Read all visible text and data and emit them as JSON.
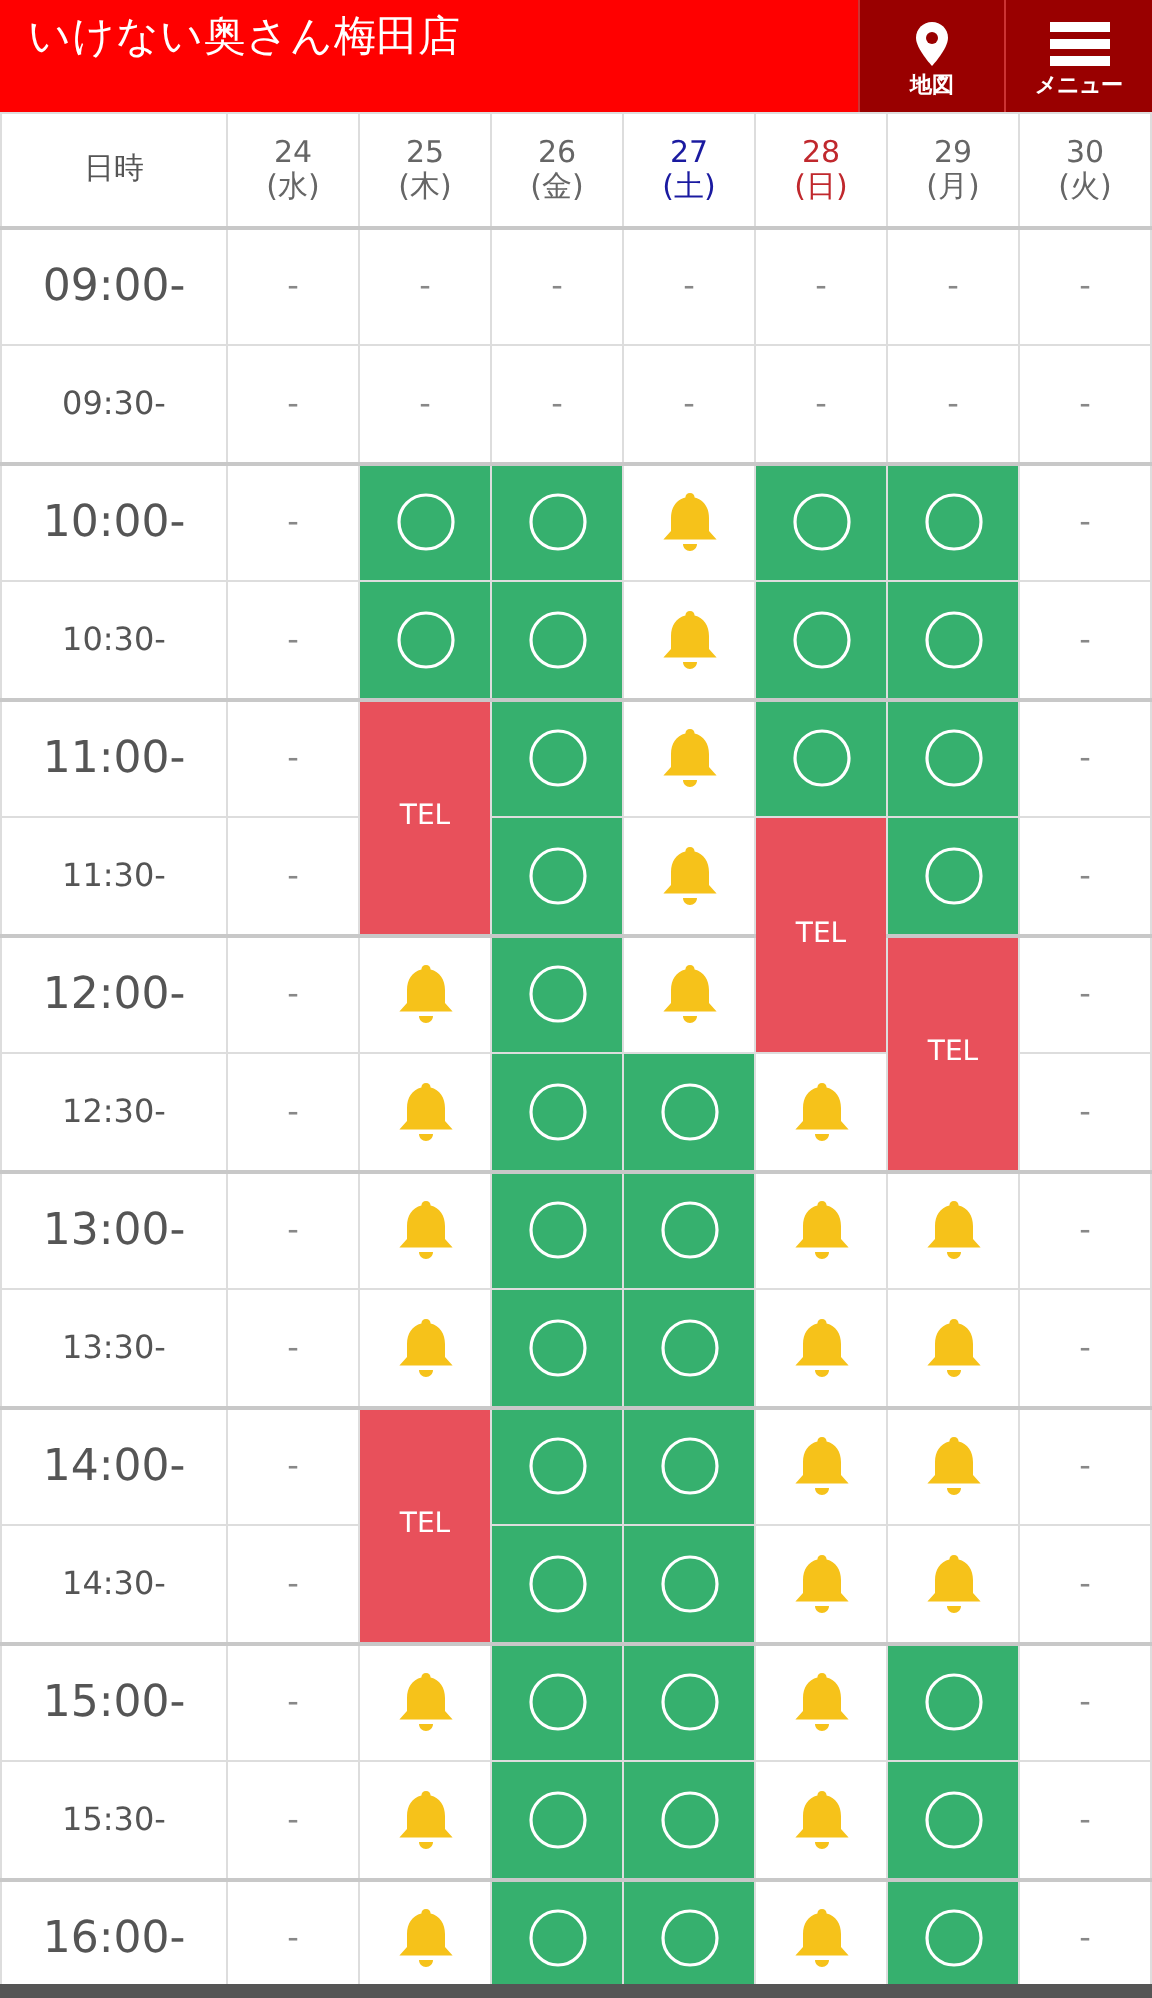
{
  "header": {
    "title": "いけない奥さん梅田店",
    "buttons": [
      {
        "kind": "map",
        "label": "地図"
      },
      {
        "kind": "menu",
        "label": "メニュー"
      }
    ]
  },
  "table": {
    "corner": "日時",
    "days": [
      {
        "date": "24",
        "weekday": "(水)",
        "color": "#666666"
      },
      {
        "date": "25",
        "weekday": "(木)",
        "color": "#666666"
      },
      {
        "date": "26",
        "weekday": "(金)",
        "color": "#666666"
      },
      {
        "date": "27",
        "weekday": "(土)",
        "color": "#1a1aa0"
      },
      {
        "date": "28",
        "weekday": "(日)",
        "color": "#c0282d"
      },
      {
        "date": "29",
        "weekday": "(月)",
        "color": "#666666"
      },
      {
        "date": "30",
        "weekday": "(火)",
        "color": "#666666"
      }
    ],
    "rows": [
      {
        "time": "09:00-",
        "kind": "hour",
        "cells": [
          {
            "kind": "dash",
            "text": "-"
          },
          {
            "kind": "dash",
            "text": "-"
          },
          {
            "kind": "dash",
            "text": "-"
          },
          {
            "kind": "dash",
            "text": "-"
          },
          {
            "kind": "dash",
            "text": "-"
          },
          {
            "kind": "dash",
            "text": "-"
          },
          {
            "kind": "dash",
            "text": "-"
          }
        ]
      },
      {
        "time": "09:30-",
        "kind": "half",
        "cells": [
          {
            "kind": "dash",
            "text": "-"
          },
          {
            "kind": "dash",
            "text": "-"
          },
          {
            "kind": "dash",
            "text": "-"
          },
          {
            "kind": "dash",
            "text": "-"
          },
          {
            "kind": "dash",
            "text": "-"
          },
          {
            "kind": "dash",
            "text": "-"
          },
          {
            "kind": "dash",
            "text": "-"
          }
        ]
      },
      {
        "time": "10:00-",
        "kind": "hour",
        "cells": [
          {
            "kind": "dash",
            "text": "-"
          },
          {
            "kind": "open"
          },
          {
            "kind": "open"
          },
          {
            "kind": "bell"
          },
          {
            "kind": "open"
          },
          {
            "kind": "open"
          },
          {
            "kind": "dash",
            "text": "-"
          }
        ]
      },
      {
        "time": "10:30-",
        "kind": "half",
        "cells": [
          {
            "kind": "dash",
            "text": "-"
          },
          {
            "kind": "open"
          },
          {
            "kind": "open"
          },
          {
            "kind": "bell"
          },
          {
            "kind": "open"
          },
          {
            "kind": "open"
          },
          {
            "kind": "dash",
            "text": "-"
          }
        ]
      },
      {
        "time": "11:00-",
        "kind": "hour",
        "cells": [
          {
            "kind": "dash",
            "text": "-"
          },
          {
            "kind": "tel",
            "text": "TEL",
            "rowspan": 2
          },
          {
            "kind": "open"
          },
          {
            "kind": "bell"
          },
          {
            "kind": "open"
          },
          {
            "kind": "open"
          },
          {
            "kind": "dash",
            "text": "-"
          }
        ]
      },
      {
        "time": "11:30-",
        "kind": "half",
        "cells": [
          {
            "kind": "dash",
            "text": "-"
          },
          {
            "kind": "open"
          },
          {
            "kind": "bell"
          },
          {
            "kind": "tel",
            "text": "TEL",
            "rowspan": 2
          },
          {
            "kind": "open"
          },
          {
            "kind": "dash",
            "text": "-"
          }
        ]
      },
      {
        "time": "12:00-",
        "kind": "hour",
        "cells": [
          {
            "kind": "dash",
            "text": "-"
          },
          {
            "kind": "bell"
          },
          {
            "kind": "open"
          },
          {
            "kind": "bell"
          },
          {
            "kind": "tel",
            "text": "TEL",
            "rowspan": 2
          },
          {
            "kind": "dash",
            "text": "-"
          }
        ]
      },
      {
        "time": "12:30-",
        "kind": "half",
        "cells": [
          {
            "kind": "dash",
            "text": "-"
          },
          {
            "kind": "bell"
          },
          {
            "kind": "open"
          },
          {
            "kind": "open"
          },
          {
            "kind": "bell"
          },
          {
            "kind": "dash",
            "text": "-"
          }
        ]
      },
      {
        "time": "13:00-",
        "kind": "hour",
        "cells": [
          {
            "kind": "dash",
            "text": "-"
          },
          {
            "kind": "bell"
          },
          {
            "kind": "open"
          },
          {
            "kind": "open"
          },
          {
            "kind": "bell"
          },
          {
            "kind": "bell"
          },
          {
            "kind": "dash",
            "text": "-"
          }
        ]
      },
      {
        "time": "13:30-",
        "kind": "half",
        "cells": [
          {
            "kind": "dash",
            "text": "-"
          },
          {
            "kind": "bell"
          },
          {
            "kind": "open"
          },
          {
            "kind": "open"
          },
          {
            "kind": "bell"
          },
          {
            "kind": "bell"
          },
          {
            "kind": "dash",
            "text": "-"
          }
        ]
      },
      {
        "time": "14:00-",
        "kind": "hour",
        "cells": [
          {
            "kind": "dash",
            "text": "-"
          },
          {
            "kind": "tel",
            "text": "TEL",
            "rowspan": 2
          },
          {
            "kind": "open"
          },
          {
            "kind": "open"
          },
          {
            "kind": "bell"
          },
          {
            "kind": "bell"
          },
          {
            "kind": "dash",
            "text": "-"
          }
        ]
      },
      {
        "time": "14:30-",
        "kind": "half",
        "cells": [
          {
            "kind": "dash",
            "text": "-"
          },
          {
            "kind": "open"
          },
          {
            "kind": "open"
          },
          {
            "kind": "bell"
          },
          {
            "kind": "bell"
          },
          {
            "kind": "dash",
            "text": "-"
          }
        ]
      },
      {
        "time": "15:00-",
        "kind": "hour",
        "cells": [
          {
            "kind": "dash",
            "text": "-"
          },
          {
            "kind": "bell"
          },
          {
            "kind": "open"
          },
          {
            "kind": "open"
          },
          {
            "kind": "bell"
          },
          {
            "kind": "open"
          },
          {
            "kind": "dash",
            "text": "-"
          }
        ]
      },
      {
        "time": "15:30-",
        "kind": "half",
        "cells": [
          {
            "kind": "dash",
            "text": "-"
          },
          {
            "kind": "bell"
          },
          {
            "kind": "open"
          },
          {
            "kind": "open"
          },
          {
            "kind": "bell"
          },
          {
            "kind": "open"
          },
          {
            "kind": "dash",
            "text": "-"
          }
        ]
      },
      {
        "time": "16:00-",
        "kind": "hour",
        "cells": [
          {
            "kind": "dash",
            "text": "-"
          },
          {
            "kind": "bell"
          },
          {
            "kind": "open"
          },
          {
            "kind": "open"
          },
          {
            "kind": "bell"
          },
          {
            "kind": "open"
          },
          {
            "kind": "dash",
            "text": "-"
          }
        ]
      }
    ]
  }
}
